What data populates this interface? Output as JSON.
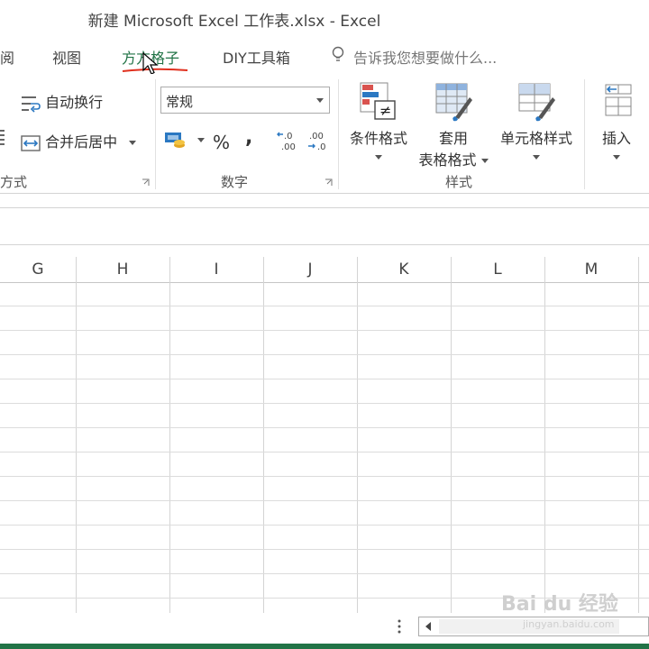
{
  "window": {
    "title": "新建 Microsoft Excel 工作表.xlsx - Excel"
  },
  "tabs": [
    {
      "label": "阅"
    },
    {
      "label": "视图"
    },
    {
      "label": "方方格子",
      "active": true
    },
    {
      "label": "DIY工具箱"
    }
  ],
  "tell_me": {
    "placeholder": "告诉我您想要做什么..."
  },
  "ribbon": {
    "alignment": {
      "wrap_text": "自动换行",
      "merge_center": "合并后居中",
      "group_label": "方式"
    },
    "number": {
      "format_value": "常规",
      "percent": "%",
      "comma": ",",
      "inc_decimal": ".0 .00",
      "dec_decimal": ".00 .0",
      "group_label": "数字"
    },
    "styles": {
      "conditional": "条件格式",
      "table_line1": "套用",
      "table_line2": "表格格式",
      "cell_styles": "单元格样式",
      "group_label": "样式"
    },
    "cells": {
      "insert": "插入"
    }
  },
  "columns": [
    "G",
    "H",
    "I",
    "J",
    "K",
    "L",
    "M"
  ],
  "colors": {
    "accent": "#217346",
    "annotation": "#e0301e"
  },
  "watermark": {
    "brand": "Bai du 经验",
    "url": "jingyan.baidu.com"
  }
}
